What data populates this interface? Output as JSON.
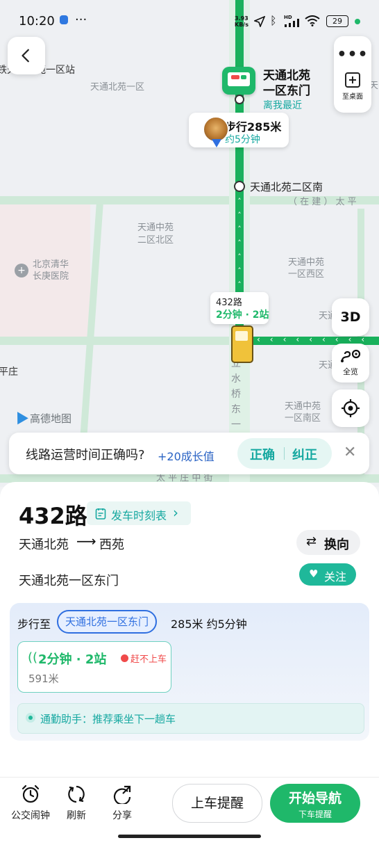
{
  "status_bar": {
    "time": "10:20",
    "network_speed_top": "3.93",
    "network_speed_unit": "KB/s",
    "hd_label": "HD",
    "battery": "29"
  },
  "map": {
    "labels": {
      "top_left_station": "铁天通北苑一区站",
      "area_1": "天通北苑一区",
      "area_2a": "天通中苑",
      "area_2b": "二区北区",
      "area_3a": "天通中苑",
      "area_3b": "一区西区",
      "area_4a": "天通中苑",
      "area_4b": "一区南区",
      "hospital_a": "北京清华",
      "hospital_b": "长庚医院",
      "stop_2": "天通北苑二区南",
      "road_construction": "（ 在 建 ） 太 平",
      "left_village": "平庄",
      "road_vertical": "立水桥东一",
      "right_tong_1": "天通",
      "right_tong_2": "天通",
      "right_top_edge": "天",
      "bottom_road": "太 平 庄 中 街"
    },
    "station_callout": {
      "name_line1": "天通北苑",
      "name_line2": "一区东门",
      "sub": "离我最近"
    },
    "walk_bubble": {
      "distance": "步行285米",
      "time": "约5分钟"
    },
    "bus_bubble": {
      "route": "432路",
      "eta": "2分钟 · 2站"
    },
    "logo_text": "高德地图",
    "to_desktop_label": "至桌面",
    "three_d_label": "3D",
    "overview_label": "全览",
    "feedback": {
      "question": "线路运营时间正确吗?",
      "reward": "+20成长值",
      "correct": "正确",
      "fix": "纠正"
    }
  },
  "sheet": {
    "route_name": "432路",
    "timetable_label": "发车时刻表",
    "from": "天通北苑",
    "to": "西苑",
    "switch_label": "换向",
    "stop_name": "天通北苑一区东门",
    "follow_label": "关注",
    "walk_prefix": "步行至",
    "walk_target": "天通北苑一区东门",
    "walk_info": "285米 约5分钟",
    "bus_card": {
      "eta": "2分钟 · 2站",
      "warning": "赶不上车",
      "distance": "591米"
    },
    "assistant": "通勤助手：推荐乘坐下一趟车"
  },
  "bottom_bar": {
    "alarm_label": "公交闹钟",
    "refresh_label": "刷新",
    "share_label": "分享",
    "board_remind_label": "上车提醒",
    "nav_label": "开始导航",
    "nav_sub_label": "下车提醒"
  },
  "colors": {
    "primary_green": "#1fb86a",
    "teal": "#15a8a0",
    "blue": "#2f6fe0",
    "route_green": "#19b15c"
  }
}
